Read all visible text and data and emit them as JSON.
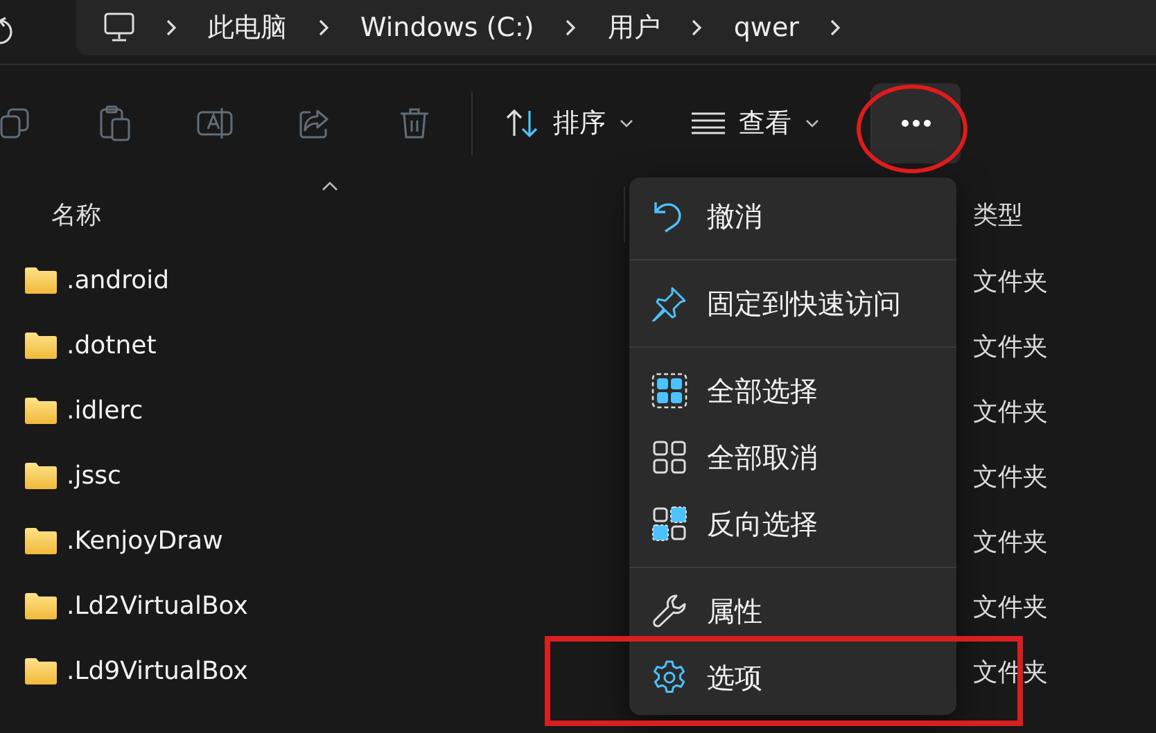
{
  "breadcrumb": [
    "此电脑",
    "Windows (C:)",
    "用户",
    "qwer"
  ],
  "toolbar": {
    "actions": [
      {
        "kind": "copy",
        "disabled": true
      },
      {
        "kind": "paste",
        "disabled": true
      },
      {
        "kind": "rename",
        "disabled": true
      },
      {
        "kind": "share",
        "disabled": true
      },
      {
        "kind": "delete",
        "disabled": true
      }
    ],
    "sort_label": "排序",
    "view_label": "查看"
  },
  "columns": {
    "name": "名称",
    "type": "类型"
  },
  "rows": [
    {
      "name": ".android",
      "type": "文件夹"
    },
    {
      "name": ".dotnet",
      "type": "文件夹"
    },
    {
      "name": ".idlerc",
      "type": "文件夹"
    },
    {
      "name": ".jssc",
      "type": "文件夹"
    },
    {
      "name": ".KenjoyDraw",
      "type": "文件夹"
    },
    {
      "name": ".Ld2VirtualBox",
      "type": "文件夹"
    },
    {
      "name": ".Ld9VirtualBox",
      "type": "文件夹"
    }
  ],
  "menu": {
    "groups": [
      [
        {
          "kind": "undo",
          "label": "撤消"
        }
      ],
      [
        {
          "kind": "pin",
          "label": "固定到快速访问"
        }
      ],
      [
        {
          "kind": "select-all",
          "label": "全部选择"
        },
        {
          "kind": "select-none",
          "label": "全部取消"
        },
        {
          "kind": "invert",
          "label": "反向选择"
        }
      ],
      [
        {
          "kind": "properties",
          "label": "属性"
        },
        {
          "kind": "options",
          "label": "选项"
        }
      ]
    ]
  }
}
